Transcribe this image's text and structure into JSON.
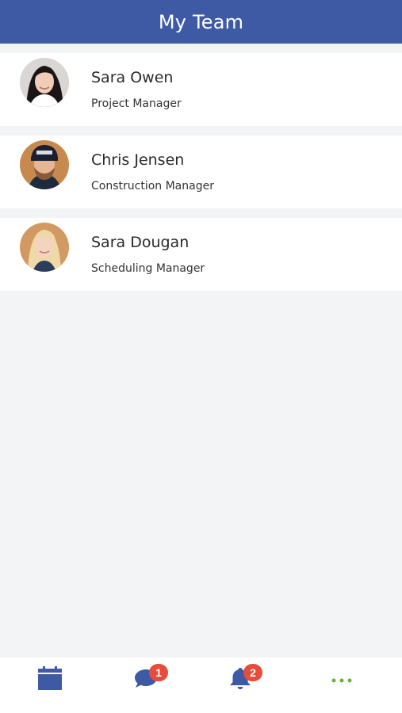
{
  "header": {
    "title": "My Team"
  },
  "team": [
    {
      "name": "Sara Owen",
      "role": "Project Manager"
    },
    {
      "name": "Chris Jensen",
      "role": "Construction Manager"
    },
    {
      "name": "Sara Dougan",
      "role": "Scheduling Manager"
    }
  ],
  "tabbar": {
    "calendar_icon": "calendar-icon",
    "messages_icon": "chat-bubble-icon",
    "messages_badge": "1",
    "notifications_icon": "bell-icon",
    "notifications_badge": "2",
    "more_icon": "more-dots-icon"
  },
  "colors": {
    "header_bg": "#3f5aa4",
    "badge": "#e74c3c",
    "more_dots": "#6ab23a",
    "page_bg": "#f3f4f6"
  }
}
